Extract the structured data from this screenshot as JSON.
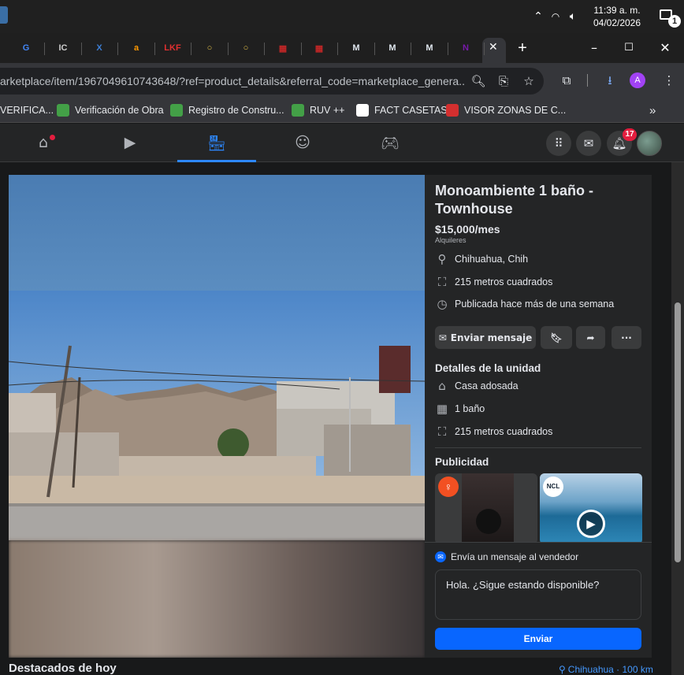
{
  "taskbar": {
    "time": "11:39 a. m.",
    "date": "04/02/2026",
    "notifications_count": "1",
    "icons": [
      "chevron-up-icon",
      "wifi-icon",
      "volume-icon",
      "notification-icon"
    ]
  },
  "browser": {
    "tabs": [
      {
        "icon": "google-icon",
        "glyph": "G",
        "color": "#4285f4"
      },
      {
        "icon": "site-icon",
        "glyph": "IC",
        "color": "#cccccc"
      },
      {
        "icon": "site-icon",
        "glyph": "X",
        "color": "#3d7fd6"
      },
      {
        "icon": "amazon-icon",
        "glyph": "a",
        "color": "#ff9900"
      },
      {
        "icon": "lkf-icon",
        "glyph": "LKF",
        "color": "#e03030"
      },
      {
        "icon": "site-icon",
        "glyph": "○",
        "color": "#e6c34a"
      },
      {
        "icon": "site-icon",
        "glyph": "○",
        "color": "#e6c34a"
      },
      {
        "icon": "site-icon",
        "glyph": "▦",
        "color": "#c02626"
      },
      {
        "icon": "site-icon",
        "glyph": "▦",
        "color": "#c02626"
      },
      {
        "icon": "doc-icon",
        "glyph": "M",
        "color": "#dfe6ee"
      },
      {
        "icon": "doc-icon",
        "glyph": "M",
        "color": "#dfe6ee"
      },
      {
        "icon": "doc-icon",
        "glyph": "M",
        "color": "#dfe6ee"
      },
      {
        "icon": "onenote-icon",
        "glyph": "N",
        "color": "#7719aa"
      }
    ],
    "new_tab_symbol": "+",
    "url": "arketplace/item/1967049610743648/?ref=product_details&referral_code=marketplace_genera...",
    "profile_initial": "A",
    "bookmarks": [
      {
        "label": "VERIFICA...",
        "color": "#e53935"
      },
      {
        "label": "Verificación de Obra",
        "color": "#43a047"
      },
      {
        "label": "Registro de Constru...",
        "color": "#43a047"
      },
      {
        "label": "RUV ++",
        "color": "#43a047"
      },
      {
        "label": "FACT CASETAS",
        "color": "#ffffff"
      },
      {
        "label": "VISOR ZONAS DE C...",
        "color": "#d32f2f"
      }
    ],
    "bookmarks_more": "»"
  },
  "facebook_nav": {
    "notification_badge": "17",
    "active_tab": "marketplace"
  },
  "listing": {
    "title": "Monoambiente 1 baño - Townhouse",
    "price": "$15,000/mes",
    "category": "Alquileres",
    "location": "Chihuahua, Chih",
    "area": "215 metros cuadrados",
    "posted": "Publicada hace más de una semana",
    "actions": {
      "message_label": "Enviar mensaje",
      "more_symbol": "···"
    },
    "details_heading": "Detalles de la unidad",
    "details": [
      {
        "icon": "house-icon",
        "label": "Casa adosada"
      },
      {
        "icon": "bath-icon",
        "label": "1 baño"
      },
      {
        "icon": "area-icon",
        "label": "215 metros cuadrados"
      }
    ],
    "ads_heading": "Publicidad",
    "ad_brand_left": "orange-brand-icon",
    "ad_brand_right": "NCL",
    "message": {
      "heading": "Envía un mensaje al vendedor",
      "text": "Hola. ¿Sigue estando disponible?",
      "send_label": "Enviar"
    }
  },
  "footer": {
    "featured_heading": "Destacados de hoy",
    "location_filter": "Chihuahua · 100 km"
  },
  "colors": {
    "accent": "#0866ff",
    "nav_active": "#2d88ff",
    "panel_bg": "#242526",
    "page_bg": "#18191a"
  }
}
